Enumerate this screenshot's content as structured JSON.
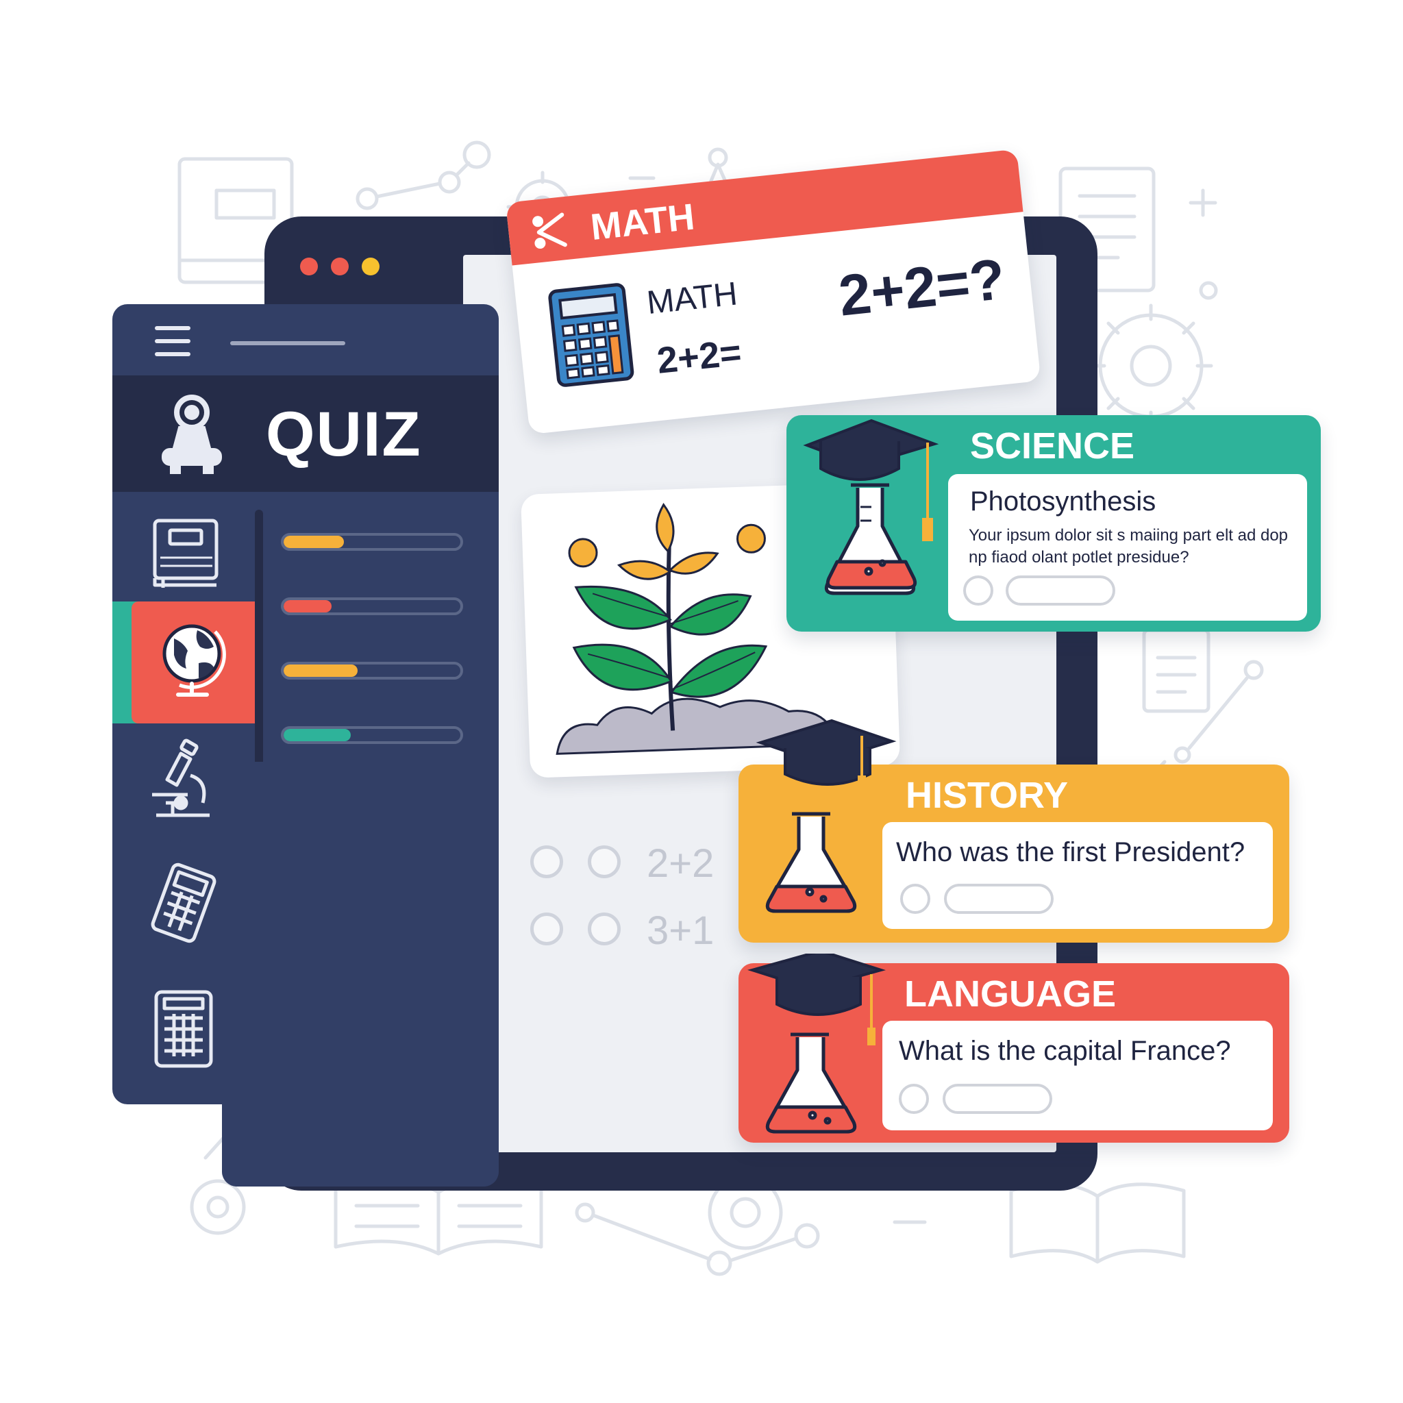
{
  "colors": {
    "navy": "#262d4a",
    "sidebar": "#323f66",
    "accent_red": "#ef5b4f",
    "accent_teal": "#2eb39a",
    "accent_orange": "#f6b13a",
    "text_dark": "#1f2440"
  },
  "window": {
    "controls": [
      "close-dot",
      "minimize-dot",
      "maximize-dot"
    ]
  },
  "sidebar": {
    "menu_icon": "hamburger-icon",
    "title": "QUIZ",
    "title_icon": "trophy-icon",
    "items": [
      {
        "icon": "book-icon",
        "active": false,
        "progress": 0.34
      },
      {
        "icon": "globe-icon",
        "active": true,
        "progress": 0.27
      },
      {
        "icon": "microscope-icon",
        "active": false,
        "progress": 0.42
      },
      {
        "icon": "calculator-icon",
        "active": false,
        "progress": 0.38
      },
      {
        "icon": "calculator-grid-icon",
        "active": false
      }
    ]
  },
  "math_card": {
    "tab_label": "MATH",
    "subtitle": "MATH",
    "equation_small": "2+2=",
    "equation_big": "2+2=?"
  },
  "options": [
    {
      "label": "2+2"
    },
    {
      "label": "3+1"
    }
  ],
  "cards": {
    "science": {
      "title": "SCIENCE",
      "question": "Photosynthesis",
      "body": "Your ipsum dolor sit s maiing part elt ad dop np fiaod olant potlet presidue?"
    },
    "history": {
      "title": "HISTORY",
      "question": "Who was the first President?"
    },
    "language": {
      "title": "LANGUAGE",
      "question": "What is the capital France?"
    }
  }
}
